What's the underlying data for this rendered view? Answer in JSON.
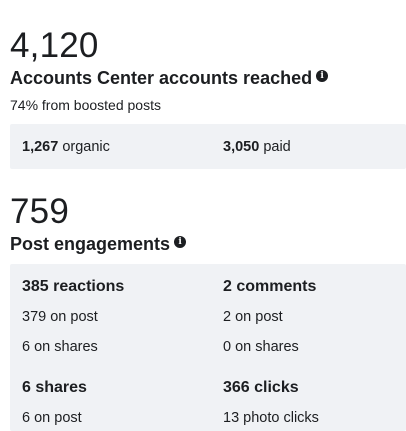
{
  "reach": {
    "number": "4,120",
    "title": "Accounts Center accounts reached",
    "subtext": "74% from boosted posts",
    "organic_value": "1,267",
    "organic_label": "organic",
    "paid_value": "3,050",
    "paid_label": "paid"
  },
  "engagements": {
    "number": "759",
    "title": "Post engagements",
    "reactions": {
      "heading": "385 reactions",
      "on_post_value": "379",
      "on_post_label": "on post",
      "on_shares_value": "6",
      "on_shares_label": "on shares"
    },
    "comments": {
      "heading": "2 comments",
      "on_post_value": "2",
      "on_post_label": "on post",
      "on_shares_value": "0",
      "on_shares_label": "on shares"
    },
    "shares": {
      "heading": "6 shares",
      "on_post_value": "6",
      "on_post_label": "on post"
    },
    "clicks": {
      "heading": "366 clicks",
      "photo_clicks_value": "13",
      "photo_clicks_label": "photo clicks"
    }
  },
  "icons": {
    "info": "info-icon"
  }
}
